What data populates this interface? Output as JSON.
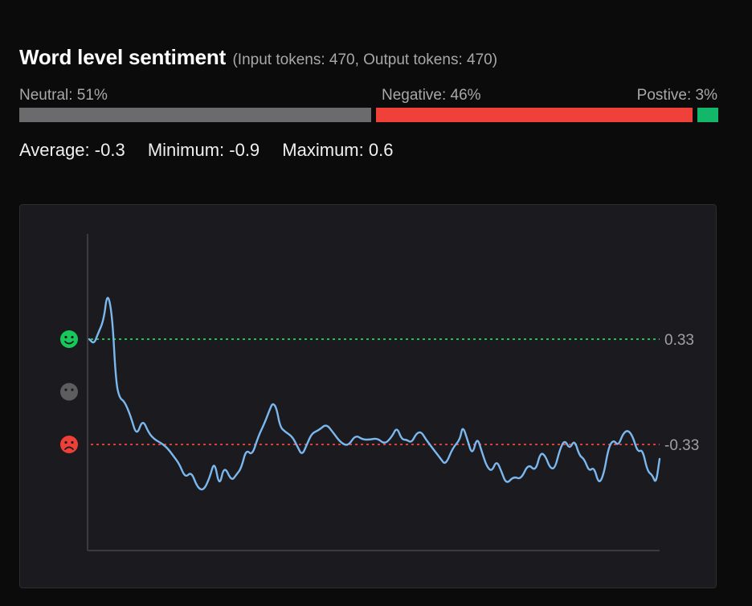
{
  "header": {
    "title": "Word level sentiment",
    "subtitle": "(Input tokens: 470, Output tokens: 470)"
  },
  "distribution": {
    "neutral": {
      "label": "Neutral: 51%",
      "percent": 51,
      "color": "#6b6b6d"
    },
    "negative": {
      "label": "Negative: 46%",
      "percent": 46,
      "color": "#f0403a"
    },
    "positive": {
      "label": "Postive: 3%",
      "percent": 3,
      "color": "#12b76a"
    }
  },
  "stats": {
    "average": "Average: -0.3",
    "minimum": "Minimum: -0.9",
    "maximum": "Maximum: 0.6"
  },
  "chart_data": {
    "type": "line",
    "title": "",
    "xlabel": "",
    "ylabel": "",
    "x_range": [
      1,
      470
    ],
    "ylim": [
      -1.0,
      1.0
    ],
    "grid": false,
    "legend": "none",
    "thresholds": [
      {
        "value": 0.33,
        "label": "0.33",
        "color": "#1fbf5a"
      },
      {
        "value": -0.33,
        "label": "-0.33",
        "color": "#d8413b"
      }
    ],
    "level_icons": [
      {
        "name": "positive-face-icon",
        "value": 0.33,
        "color": "#17c85b"
      },
      {
        "name": "neutral-face-icon",
        "value": 0.0,
        "color": "#5d5d60"
      },
      {
        "name": "negative-face-icon",
        "value": -0.33,
        "color": "#ef4038"
      }
    ],
    "series": [
      {
        "color": "#7cb8f0",
        "points": [
          [
            1,
            0.33
          ],
          [
            5,
            0.3
          ],
          [
            8,
            0.36
          ],
          [
            13,
            0.45
          ],
          [
            16,
            0.63
          ],
          [
            20,
            0.48
          ],
          [
            23,
            0.06
          ],
          [
            26,
            -0.04
          ],
          [
            30,
            -0.06
          ],
          [
            35,
            -0.15
          ],
          [
            40,
            -0.28
          ],
          [
            45,
            -0.17
          ],
          [
            50,
            -0.26
          ],
          [
            55,
            -0.3
          ],
          [
            60,
            -0.32
          ],
          [
            65,
            -0.35
          ],
          [
            70,
            -0.4
          ],
          [
            75,
            -0.45
          ],
          [
            80,
            -0.54
          ],
          [
            85,
            -0.5
          ],
          [
            90,
            -0.6
          ],
          [
            95,
            -0.62
          ],
          [
            100,
            -0.54
          ],
          [
            104,
            -0.43
          ],
          [
            108,
            -0.6
          ],
          [
            112,
            -0.46
          ],
          [
            118,
            -0.56
          ],
          [
            122,
            -0.52
          ],
          [
            126,
            -0.48
          ],
          [
            130,
            -0.36
          ],
          [
            135,
            -0.4
          ],
          [
            140,
            -0.28
          ],
          [
            145,
            -0.2
          ],
          [
            150,
            -0.1
          ],
          [
            152,
            -0.07
          ],
          [
            155,
            -0.1
          ],
          [
            158,
            -0.22
          ],
          [
            162,
            -0.25
          ],
          [
            168,
            -0.28
          ],
          [
            172,
            -0.34
          ],
          [
            176,
            -0.4
          ],
          [
            180,
            -0.33
          ],
          [
            184,
            -0.26
          ],
          [
            190,
            -0.24
          ],
          [
            196,
            -0.2
          ],
          [
            202,
            -0.26
          ],
          [
            208,
            -0.32
          ],
          [
            214,
            -0.34
          ],
          [
            220,
            -0.27
          ],
          [
            226,
            -0.3
          ],
          [
            232,
            -0.3
          ],
          [
            238,
            -0.29
          ],
          [
            244,
            -0.33
          ],
          [
            250,
            -0.28
          ],
          [
            254,
            -0.22
          ],
          [
            258,
            -0.3
          ],
          [
            262,
            -0.3
          ],
          [
            266,
            -0.32
          ],
          [
            270,
            -0.26
          ],
          [
            274,
            -0.25
          ],
          [
            278,
            -0.3
          ],
          [
            282,
            -0.34
          ],
          [
            286,
            -0.38
          ],
          [
            290,
            -0.42
          ],
          [
            294,
            -0.46
          ],
          [
            300,
            -0.35
          ],
          [
            306,
            -0.3
          ],
          [
            308,
            -0.21
          ],
          [
            312,
            -0.3
          ],
          [
            316,
            -0.4
          ],
          [
            320,
            -0.28
          ],
          [
            324,
            -0.38
          ],
          [
            328,
            -0.47
          ],
          [
            332,
            -0.5
          ],
          [
            336,
            -0.43
          ],
          [
            340,
            -0.5
          ],
          [
            344,
            -0.58
          ],
          [
            350,
            -0.53
          ],
          [
            356,
            -0.55
          ],
          [
            362,
            -0.45
          ],
          [
            368,
            -0.5
          ],
          [
            372,
            -0.38
          ],
          [
            376,
            -0.4
          ],
          [
            380,
            -0.48
          ],
          [
            384,
            -0.48
          ],
          [
            388,
            -0.36
          ],
          [
            392,
            -0.3
          ],
          [
            396,
            -0.36
          ],
          [
            400,
            -0.3
          ],
          [
            404,
            -0.4
          ],
          [
            408,
            -0.42
          ],
          [
            412,
            -0.5
          ],
          [
            416,
            -0.47
          ],
          [
            420,
            -0.58
          ],
          [
            424,
            -0.52
          ],
          [
            428,
            -0.35
          ],
          [
            432,
            -0.3
          ],
          [
            436,
            -0.34
          ],
          [
            440,
            -0.26
          ],
          [
            444,
            -0.24
          ],
          [
            448,
            -0.28
          ],
          [
            452,
            -0.38
          ],
          [
            456,
            -0.36
          ],
          [
            460,
            -0.5
          ],
          [
            464,
            -0.52
          ],
          [
            467,
            -0.58
          ],
          [
            470,
            -0.42
          ]
        ]
      }
    ]
  }
}
